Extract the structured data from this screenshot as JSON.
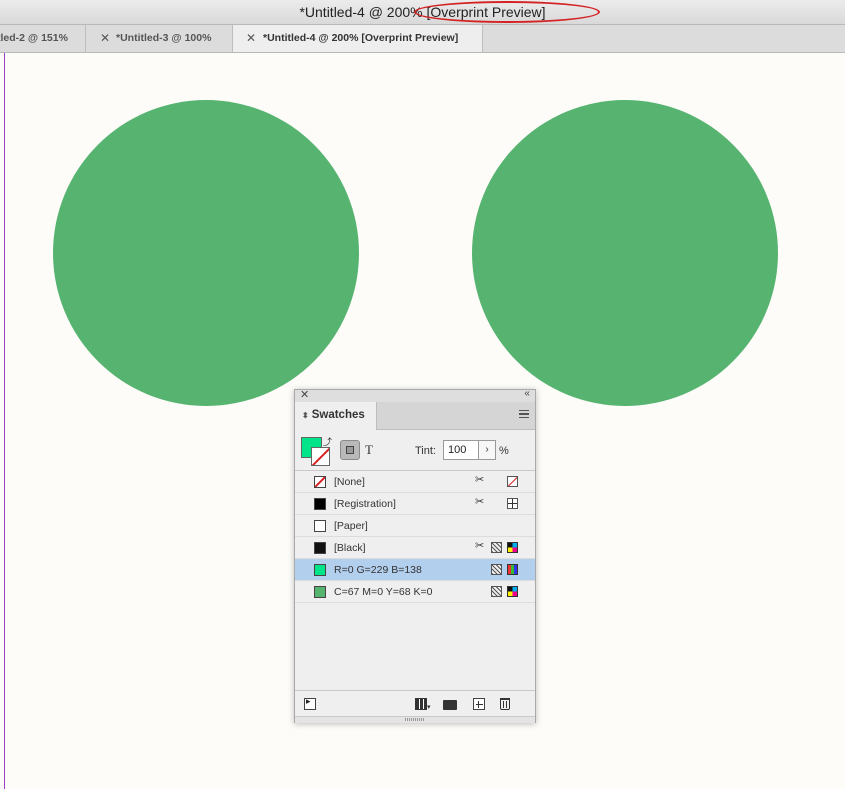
{
  "window": {
    "title": "*Untitled-4 @ 200% [Overprint Preview]"
  },
  "tabs": [
    {
      "label": "tled-2 @ 151%",
      "close": ""
    },
    {
      "label": "*Untitled-3 @ 100%",
      "close": "✕"
    },
    {
      "label": "*Untitled-4 @ 200% [Overprint Preview]",
      "close": "✕",
      "active": true
    }
  ],
  "canvas": {
    "circles": [
      {
        "color": "#56b370"
      },
      {
        "color": "#56b370"
      }
    ],
    "guide_color": "#9b3fc5"
  },
  "swatches_panel": {
    "close": "✕",
    "collapse": "‹‹",
    "tab_sort_icon": "⬍",
    "tab_label": "Swatches",
    "swap_icon": "⤴",
    "format_text": "T",
    "tint_label": "Tint:",
    "tint_value": "100",
    "tint_arrow": "›",
    "tint_unit": "%",
    "fill_color": "#00e58a",
    "noedit_icon": "✂",
    "items": [
      {
        "name": "[None]",
        "swatch": "none",
        "icons": [
          "noedit",
          "none"
        ]
      },
      {
        "name": "[Registration]",
        "swatch": "#000000",
        "icons": [
          "noedit",
          "registration"
        ]
      },
      {
        "name": "[Paper]",
        "swatch": "#ffffff",
        "icons": []
      },
      {
        "name": "[Black]",
        "swatch": "#111111",
        "icons": [
          "noedit",
          "process",
          "cmyk"
        ]
      },
      {
        "name": "R=0 G=229 B=138",
        "swatch": "#00e58a",
        "icons": [
          "process",
          "rgb"
        ],
        "selected": true
      },
      {
        "name": "C=67 M=0 Y=68 K=0",
        "swatch": "#56b370",
        "icons": [
          "process",
          "cmyk"
        ]
      }
    ]
  },
  "annotation": {
    "color": "#d42121"
  }
}
